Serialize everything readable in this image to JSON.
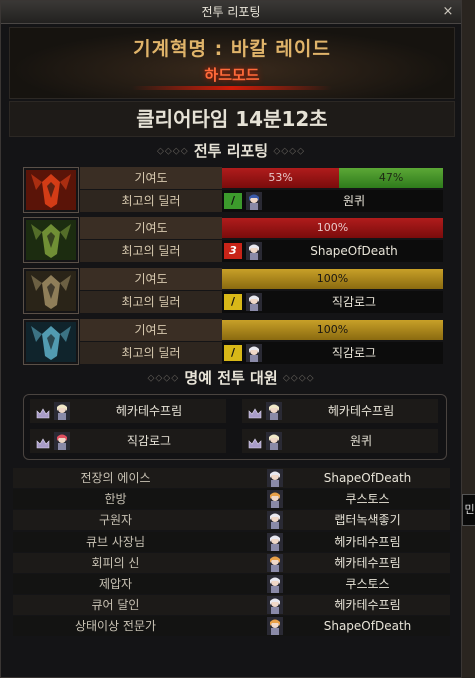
{
  "window": {
    "title": "전투 리포팅",
    "close": "×"
  },
  "header": {
    "raid_title": "기계혁명 : 바칼 레이드",
    "mode": "하드모드"
  },
  "clear_time": "클리어타임  14분12초",
  "battle_report": {
    "title": "전투 리포팅",
    "contribution_label": "기여도",
    "top_dealer_label": "최고의 딜러",
    "bosses": [
      {
        "portrait": "red-dragon-portrait",
        "segments": [
          {
            "label": "53%",
            "value": 53,
            "color": "red"
          },
          {
            "label": "47%",
            "value": 47,
            "color": "green"
          }
        ],
        "dealer_badge": "/",
        "dealer_badge_color": "green",
        "dealer_name": "원퀴"
      },
      {
        "portrait": "green-dragon-portrait",
        "segments": [
          {
            "label": "100%",
            "value": 100,
            "color": "red"
          }
        ],
        "dealer_badge": "3",
        "dealer_badge_color": "red",
        "dealer_name": "ShapeOfDeath"
      },
      {
        "portrait": "gold-dragon-portrait",
        "segments": [
          {
            "label": "100%",
            "value": 100,
            "color": "gold"
          }
        ],
        "dealer_badge": "/",
        "dealer_badge_color": "yellow",
        "dealer_name": "직감로그"
      },
      {
        "portrait": "blue-dragon-portrait",
        "segments": [
          {
            "label": "100%",
            "value": 100,
            "color": "gold"
          }
        ],
        "dealer_badge": "/",
        "dealer_badge_color": "yellow",
        "dealer_name": "직감로그"
      }
    ]
  },
  "honor_party": {
    "title": "명예 전투 대원",
    "members": [
      "헤카테수프림",
      "헤카테수프림",
      "직감로그",
      "원퀴"
    ]
  },
  "awards": [
    {
      "title": "전장의 에이스",
      "name": "ShapeOfDeath"
    },
    {
      "title": "한방",
      "name": "쿠스토스"
    },
    {
      "title": "구원자",
      "name": "랩터녹색좋기"
    },
    {
      "title": "큐브 사장님",
      "name": "헤카테수프림"
    },
    {
      "title": "회피의 신",
      "name": "헤카테수프림"
    },
    {
      "title": "제압자",
      "name": "쿠스토스"
    },
    {
      "title": "큐어 달인",
      "name": "헤카테수프림"
    },
    {
      "title": "상태이상 전문가",
      "name": "ShapeOfDeath"
    }
  ],
  "side_tab": "민",
  "colors": {
    "accent_gold": "#e0b46a",
    "mode_red": "#ff6a3a",
    "bar_red": "#b01c1c",
    "bar_green": "#5ca836",
    "bar_gold": "#c8a028"
  }
}
